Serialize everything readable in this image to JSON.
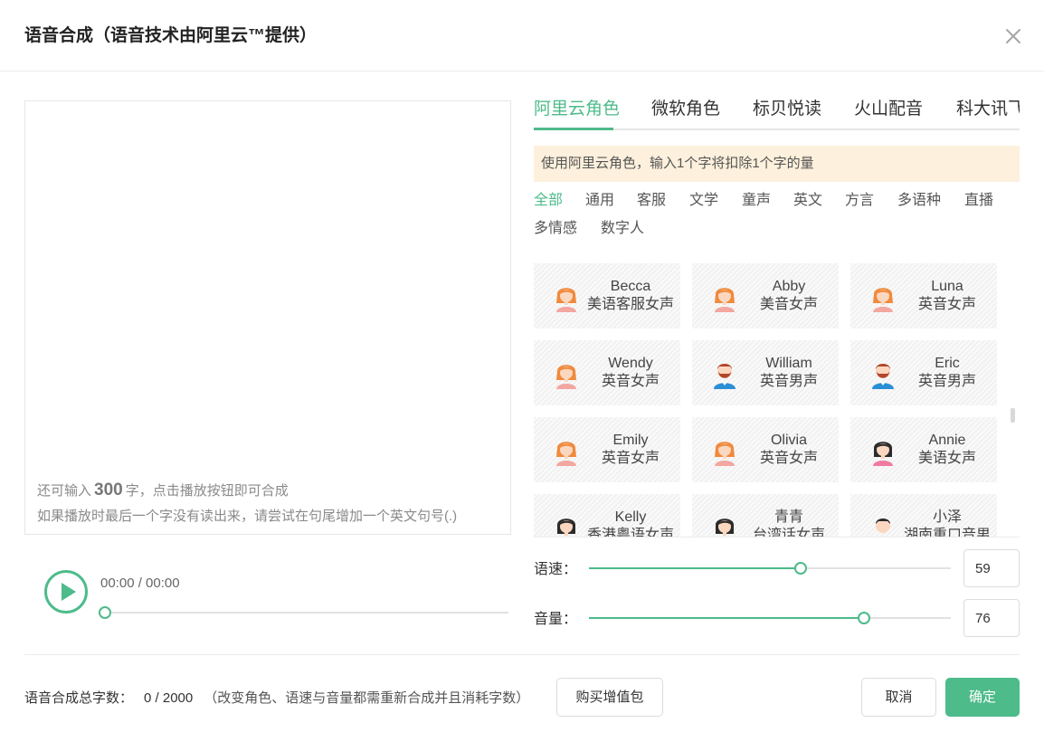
{
  "dialog": {
    "title": "语音合成（语音技术由阿里云™提供）"
  },
  "editor": {
    "hint_prefix": "还可输入",
    "hint_count": "300",
    "hint_suffix": "字，点击播放按钮即可合成",
    "hint_line2": "如果播放时最后一个字没有读出来，请尝试在句尾增加一个英文句号(.)"
  },
  "player": {
    "time": "00:00 / 00:00",
    "progress": 0
  },
  "tabs": [
    {
      "label": "阿里云角色",
      "active": true
    },
    {
      "label": "微软角色",
      "active": false
    },
    {
      "label": "标贝悦读",
      "active": false
    },
    {
      "label": "火山配音",
      "active": false
    },
    {
      "label": "科大讯飞",
      "active": false
    }
  ],
  "notice": "使用阿里云角色，输入1个字将扣除1个字的量",
  "categories": [
    {
      "label": "全部",
      "active": true
    },
    {
      "label": "通用"
    },
    {
      "label": "客服"
    },
    {
      "label": "文学"
    },
    {
      "label": "童声"
    },
    {
      "label": "英文"
    },
    {
      "label": "方言"
    },
    {
      "label": "多语种"
    },
    {
      "label": "直播"
    },
    {
      "label": "多情感"
    },
    {
      "label": "数字人"
    }
  ],
  "voices": [
    {
      "name": "Becca",
      "desc": "美语客服女声",
      "avatar": "female-redhair-icon"
    },
    {
      "name": "Abby",
      "desc": "美音女声",
      "avatar": "female-redhair-icon"
    },
    {
      "name": "Luna",
      "desc": "英音女声",
      "avatar": "female-redhair-icon"
    },
    {
      "name": "Wendy",
      "desc": "英音女声",
      "avatar": "female-redhair-icon"
    },
    {
      "name": "William",
      "desc": "英音男声",
      "avatar": "male-beard-icon"
    },
    {
      "name": "Eric",
      "desc": "英音男声",
      "avatar": "male-beard-icon"
    },
    {
      "name": "Emily",
      "desc": "英音女声",
      "avatar": "female-redhair-icon"
    },
    {
      "name": "Olivia",
      "desc": "英音女声",
      "avatar": "female-redhair-icon"
    },
    {
      "name": "Annie",
      "desc": "美语女声",
      "avatar": "female-blackhair-icon"
    },
    {
      "name": "Kelly",
      "desc": "香港粤语女声",
      "avatar": "female-blackhair-icon"
    },
    {
      "name": "青青",
      "desc": "台湾话女声",
      "avatar": "female-blackhair-icon"
    },
    {
      "name": "小泽",
      "desc": "湖南重口音男",
      "avatar": "male-black-hair-icon"
    }
  ],
  "sliders": {
    "speed": {
      "label": "语速：",
      "value": "59",
      "percent": 58.5
    },
    "volume": {
      "label": "音量：",
      "value": "76",
      "percent": 76
    }
  },
  "footer": {
    "count_label": "语音合成总字数：",
    "count_value": "0 / 2000",
    "note": "（改变角色、语速与音量都需重新合成并且消耗字数）",
    "buy_label": "购买增值包",
    "cancel_label": "取消",
    "confirm_label": "确定"
  },
  "colors": {
    "accent": "#4dbb8a",
    "notice_bg": "#fdf0dc"
  }
}
